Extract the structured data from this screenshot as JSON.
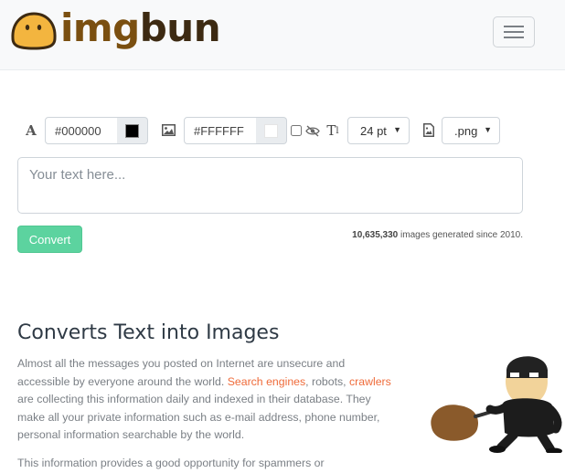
{
  "brand": {
    "name_part1": "img",
    "name_part2": "bun"
  },
  "toolbar": {
    "text_color": "#000000",
    "text_color_swatch": "#000000",
    "bg_color": "#FFFFFF",
    "bg_color_swatch": "#FFFFFF",
    "transparent_checked": false,
    "font_size": "24 pt",
    "format": ".png"
  },
  "editor": {
    "placeholder": "Your text here..."
  },
  "convert_label": "Convert",
  "counter": {
    "count": "10,635,330",
    "suffix": " images generated since 2010."
  },
  "article": {
    "heading": "Converts Text into Images",
    "p1_a": "Almost all the messages you posted on Internet are unsecure and accessible by everyone around the world. ",
    "link1": "Search engines",
    "p1_b": ", robots, ",
    "link2": "crawlers",
    "p1_c": " are collecting this information daily and indexed in their database. They make all your private information such as e-mail address, phone number, personal information searchable by the world.",
    "p2": "This information provides a good opportunity for spammers or"
  }
}
